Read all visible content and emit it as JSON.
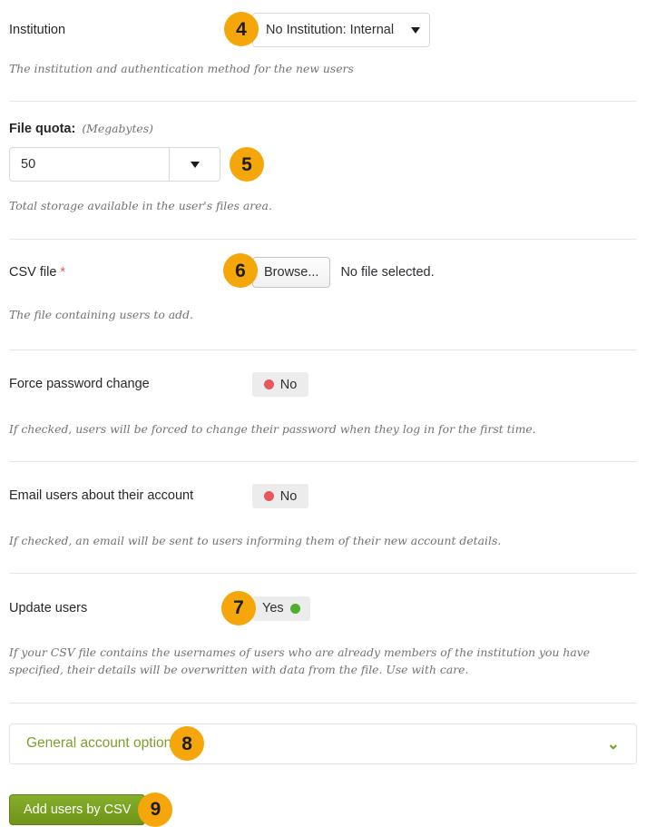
{
  "fields": {
    "institution": {
      "label": "Institution",
      "badge": "4",
      "select_value": "No Institution: Internal",
      "help": "The institution and authentication method for the new users"
    },
    "file_quota": {
      "label": "File quota:",
      "unit": "(Megabytes)",
      "badge": "5",
      "value": "50",
      "help": "Total storage available in the user's files area."
    },
    "csv_file": {
      "label": "CSV file",
      "required_mark": "*",
      "badge": "6",
      "browse_label": "Browse...",
      "file_status": "No file selected.",
      "help": "The file containing users to add."
    },
    "force_password_change": {
      "label": "Force password change",
      "switch_state": "No",
      "help": "If checked, users will be forced to change their password when they log in for the first time."
    },
    "email_users": {
      "label": "Email users about their account",
      "switch_state": "No",
      "help": "If checked, an email will be sent to users informing them of their new account details."
    },
    "update_users": {
      "label": "Update users",
      "badge": "7",
      "switch_state": "Yes",
      "help": "If your CSV file contains the usernames of users who are already members of the institution you have specified, their details will be overwritten with data from the file. Use with care."
    }
  },
  "accordion": {
    "title": "General account options",
    "badge": "8",
    "chevron": "⌄"
  },
  "submit": {
    "label": "Add users by CSV",
    "badge": "9"
  },
  "colors": {
    "badge_orange": "#f5a60b",
    "green_accent": "#7aa02b",
    "submit_green": "#6f9418",
    "switch_off_dot": "#e8575c",
    "switch_on_dot": "#4caf2e",
    "required_red": "#eb5757"
  }
}
